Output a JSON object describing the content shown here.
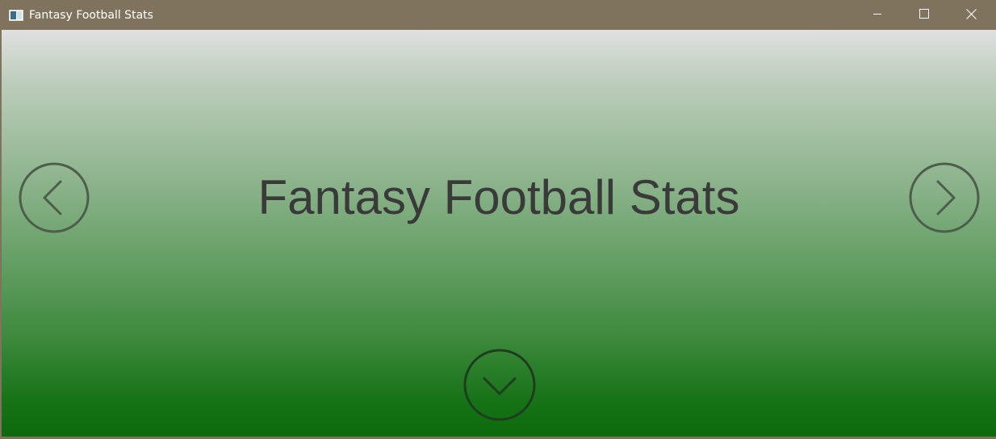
{
  "window": {
    "title": "Fantasy Football Stats",
    "controls": {
      "minimize_icon": "minimize-icon",
      "maximize_icon": "maximize-icon",
      "close_icon": "close-icon"
    },
    "colors": {
      "titlebar": "#7f735e",
      "title_text": "#ffffff"
    }
  },
  "main": {
    "headline": "Fantasy Football Stats",
    "colors": {
      "headline": "#3a3a3a",
      "gradient_top": "#e0e0e0",
      "gradient_bottom": "#0c6a0c"
    },
    "navigation": {
      "previous_icon": "chevron-left-circle-icon",
      "next_icon": "chevron-right-circle-icon",
      "down_icon": "chevron-down-circle-icon"
    }
  }
}
